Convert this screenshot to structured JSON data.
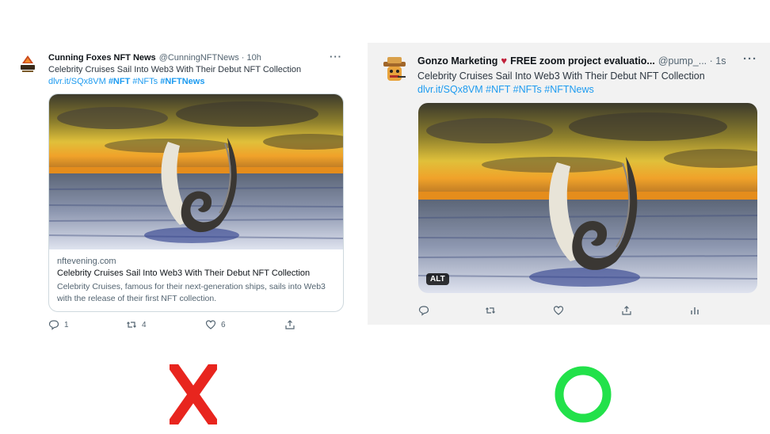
{
  "left_tweet": {
    "author_name": "Cunning Foxes NFT News",
    "author_handle": "@CunningNFTNews · 10h",
    "text": "Celebrity Cruises Sail Into Web3 With Their Debut NFT Collection",
    "link": "dlvr.it/SQx8VM",
    "hashtags": [
      "#NFT",
      "#NFTs",
      "#NFTNews"
    ],
    "card": {
      "domain": "nftevening.com",
      "title": "Celebrity Cruises Sail Into Web3 With Their Debut NFT Collection",
      "description": "Celebrity Cruises, famous for their next-generation ships, sails into Web3 with the release of their first NFT collection."
    },
    "actions": {
      "replies": "1",
      "retweets": "4",
      "likes": "6"
    },
    "verdict_mark": "X",
    "verdict_color": "#e8251e"
  },
  "right_tweet": {
    "author_name": "Gonzo Marketing",
    "author_rest": "FREE zoom project evaluatio...",
    "author_handle": "@pump_... · 1s",
    "text": "Celebrity Cruises Sail Into Web3 With Their Debut NFT Collection",
    "link": "dlvr.it/SQx8VM",
    "hashtags": [
      "#NFT",
      "#NFTs",
      "#NFTNews"
    ],
    "alt_badge": "ALT",
    "verdict_mark": "O",
    "verdict_color": "#22e14a"
  },
  "icons": [
    "more-icon",
    "reply-icon",
    "retweet-icon",
    "like-icon",
    "share-icon",
    "analytics-icon",
    "heart-emoji-icon"
  ]
}
